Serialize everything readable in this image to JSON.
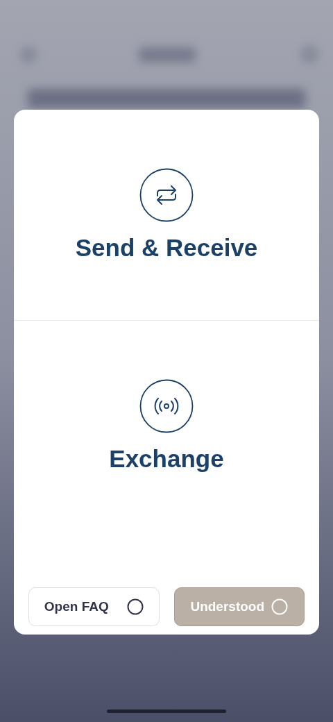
{
  "options": [
    {
      "label": "Send & Receive",
      "kind": "transfer"
    },
    {
      "label": "Exchange",
      "kind": "broadcast"
    }
  ],
  "buttons": [
    {
      "label": "Open FAQ",
      "disabled": false
    },
    {
      "label": "Understood",
      "disabled": true
    }
  ]
}
